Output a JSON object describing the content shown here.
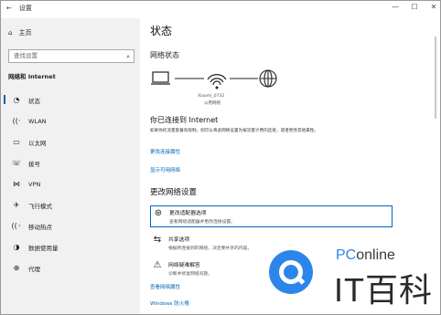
{
  "window": {
    "title": "设置",
    "controls": [
      "—",
      "☐",
      "✕"
    ]
  },
  "sidebar": {
    "home_label": "主页",
    "search_placeholder": "查找设置",
    "section": "网络和 Internet",
    "items": [
      {
        "label": "状态",
        "icon": "status-icon",
        "active": true
      },
      {
        "label": "WLAN",
        "icon": "wifi-icon",
        "active": false
      },
      {
        "label": "以太网",
        "icon": "ethernet-icon",
        "active": false
      },
      {
        "label": "拨号",
        "icon": "dialup-icon",
        "active": false
      },
      {
        "label": "VPN",
        "icon": "vpn-icon",
        "active": false
      },
      {
        "label": "飞行模式",
        "icon": "airplane-icon",
        "active": false
      },
      {
        "label": "移动热点",
        "icon": "hotspot-icon",
        "active": false
      },
      {
        "label": "数据使用量",
        "icon": "data-usage-icon",
        "active": false
      },
      {
        "label": "代理",
        "icon": "proxy-icon",
        "active": false
      }
    ]
  },
  "main": {
    "title": "状态",
    "network_status": "网络状态",
    "network_name": "Xiaomi_0732",
    "network_type": "公用网络",
    "connected_title": "你已连接到 Internet",
    "connected_desc": "如果你的流量套餐有限制，则可以将此网络设置为按流量计费的连接，或者更改其他属性。",
    "link_change_props": "更改连接属性",
    "link_show_networks": "显示可用网络",
    "change_settings_title": "更改网络设置",
    "options": [
      {
        "title": "更改适配器选项",
        "desc": "查看网络适配器并更改连接设置。",
        "icon": "adapter-icon",
        "selected": true
      },
      {
        "title": "共享选项",
        "desc": "根据所连接到的网络，决定要共享的内容。",
        "icon": "share-icon",
        "selected": false
      },
      {
        "title": "网络疑难解答",
        "desc": "诊断并修复网络问题。",
        "icon": "warning-icon",
        "selected": false
      }
    ],
    "link_view_props": "查看网络属性",
    "link_firewall": "Windows 防火墙"
  },
  "watermark": {
    "brand_prefix": "PC",
    "brand_suffix": "online",
    "big_text": "IT百科"
  }
}
